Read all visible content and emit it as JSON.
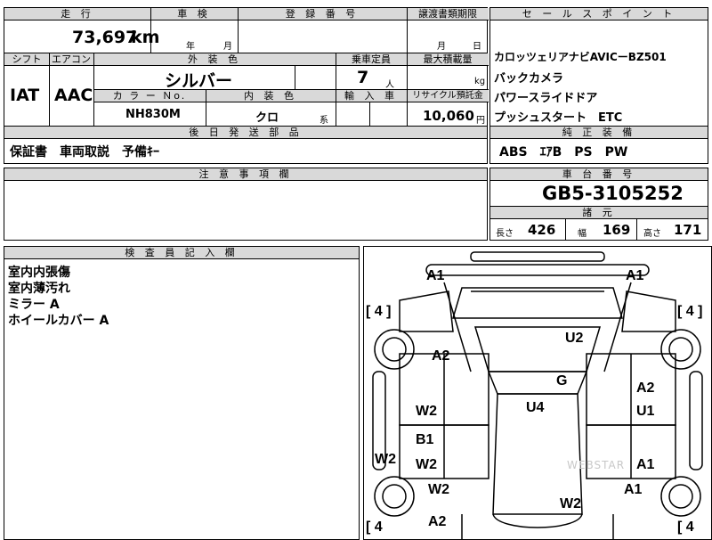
{
  "row1": {
    "mileage_label": "走 行",
    "mileage_value": "73,697",
    "mileage_unit": "km",
    "inspection_label": "車 検",
    "year_label": "年",
    "month_label": "月",
    "registration_label": "登 録 番 号",
    "transfer_label": "譲渡書類期限",
    "transfer_month_label": "月",
    "transfer_day_label": "日"
  },
  "row2": {
    "shift_label": "シフト",
    "aircon_label": "エアコン",
    "exterior_color_label": "外 装 色",
    "capacity_label": "乗車定員",
    "max_load_label": "最大積載量",
    "shift_value": "IAT",
    "aircon_value": "AAC",
    "exterior_color_value": "シルバー",
    "capacity_value": "7",
    "capacity_unit": "人",
    "load_unit": "kg",
    "color_no_label": "カ ラ ー Ｎo.",
    "interior_color_label": "内 装 色",
    "import_label": "輸 入 車",
    "recycle_label": "リサイクル預託金",
    "color_no_value": "NH830M",
    "interior_color_value": "クロ",
    "interior_color_suffix": "系",
    "recycle_value": "10,060",
    "recycle_unit": "円"
  },
  "sales_points": {
    "label": "セ ー ル ス ポ イ ン ト",
    "lines": [
      "カロッツェリアナビAVICーBZ501",
      "バックカメラ",
      "パワースライドドア",
      "プッシュスタート　ETC"
    ]
  },
  "later_parts": {
    "label": "後 日 発 送 部 品",
    "value": "保証書　車両取説　予備ｷｰ"
  },
  "genuine_equipment": {
    "label": "純 正 装 備",
    "value": "ABS　ｴｱB　PS　PW"
  },
  "notes": {
    "label": "注 意 事 項 欄"
  },
  "chassis": {
    "label": "車 台 番 号",
    "value": "GB5-3105252",
    "specs_label": "諸 元",
    "length_label": "長さ",
    "length_value": "426",
    "width_label": "幅",
    "width_value": "169",
    "height_label": "高さ",
    "height_value": "171"
  },
  "inspector": {
    "label": "検 査 員 記 入 欄",
    "lines": [
      "室内内張傷",
      "室内薄汚れ",
      "ミラー A",
      "ホイールカバー A"
    ]
  },
  "diagram": {
    "watermark": "WEBSTAR",
    "tire_tl": "[ 4 ]",
    "tire_tr": "[ 4 ]",
    "tire_bl": "[ 4",
    "tire_br": "[ 4",
    "marks": {
      "a1_tl": "A1",
      "a1_tr": "A1",
      "a2_left": "A2",
      "u2": "U2",
      "g": "G",
      "a2_right": "A2",
      "u1": "U1",
      "w2_left": "W2",
      "u4": "U4",
      "b1": "B1",
      "w2_left2": "W2",
      "w2_leftedge": "W2",
      "a1_right": "A1",
      "w2_left3": "W2",
      "a1_right2": "A1",
      "w2_bottom": "W2",
      "a2_bottom": "A2"
    }
  }
}
